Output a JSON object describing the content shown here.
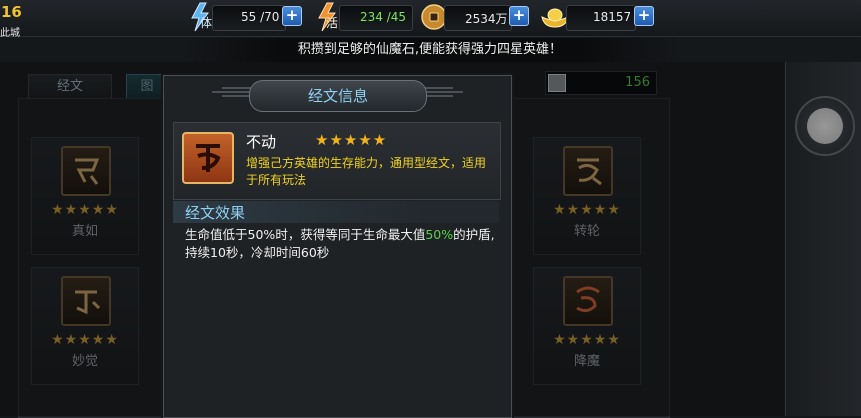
{
  "player": {
    "level": "16",
    "city": "此城"
  },
  "resources": [
    {
      "icon": "stamina-lightning-icon",
      "glyph": "体",
      "value": "55 /70"
    },
    {
      "icon": "vitality-lightning-icon",
      "glyph": "活",
      "value": "234 /45",
      "value_color": "#7de35a"
    },
    {
      "icon": "copper-coin-icon",
      "value": "2534万"
    },
    {
      "icon": "gold-ingot-icon",
      "value": "18157"
    }
  ],
  "notice": "积攒到足够的仙魔石,便能获得强力四星英雄！",
  "tabs": {
    "left": "经文",
    "right": "图"
  },
  "stone_count": "156",
  "cards": [
    {
      "name": "真如",
      "stars": "★★★★★"
    },
    {
      "name": "妙觉",
      "stars": "★★★★★"
    },
    {
      "name": "转轮",
      "stars": "★★★★★"
    },
    {
      "name": "降魔",
      "stars": "★★★★★"
    }
  ],
  "modal": {
    "title": "经文信息",
    "scripture": {
      "name": "不动",
      "stars": "★★★★★",
      "description": "增强己方英雄的生存能力，通用型经文，适用于所有玩法"
    },
    "effect_title": "经文效果",
    "effect": {
      "p1": "生命值低于",
      "v1": "50%",
      "p2": "时，获得等同于生命最大值",
      "v2": "50%",
      "p3": "的护盾,持续10秒，冷却时间60秒"
    }
  },
  "colors": {
    "accent_blue": "#8fd0f2",
    "desc_yellow": "#f1d21f",
    "star_gold": "#f2b21c",
    "highlight_green": "#58d34a"
  }
}
